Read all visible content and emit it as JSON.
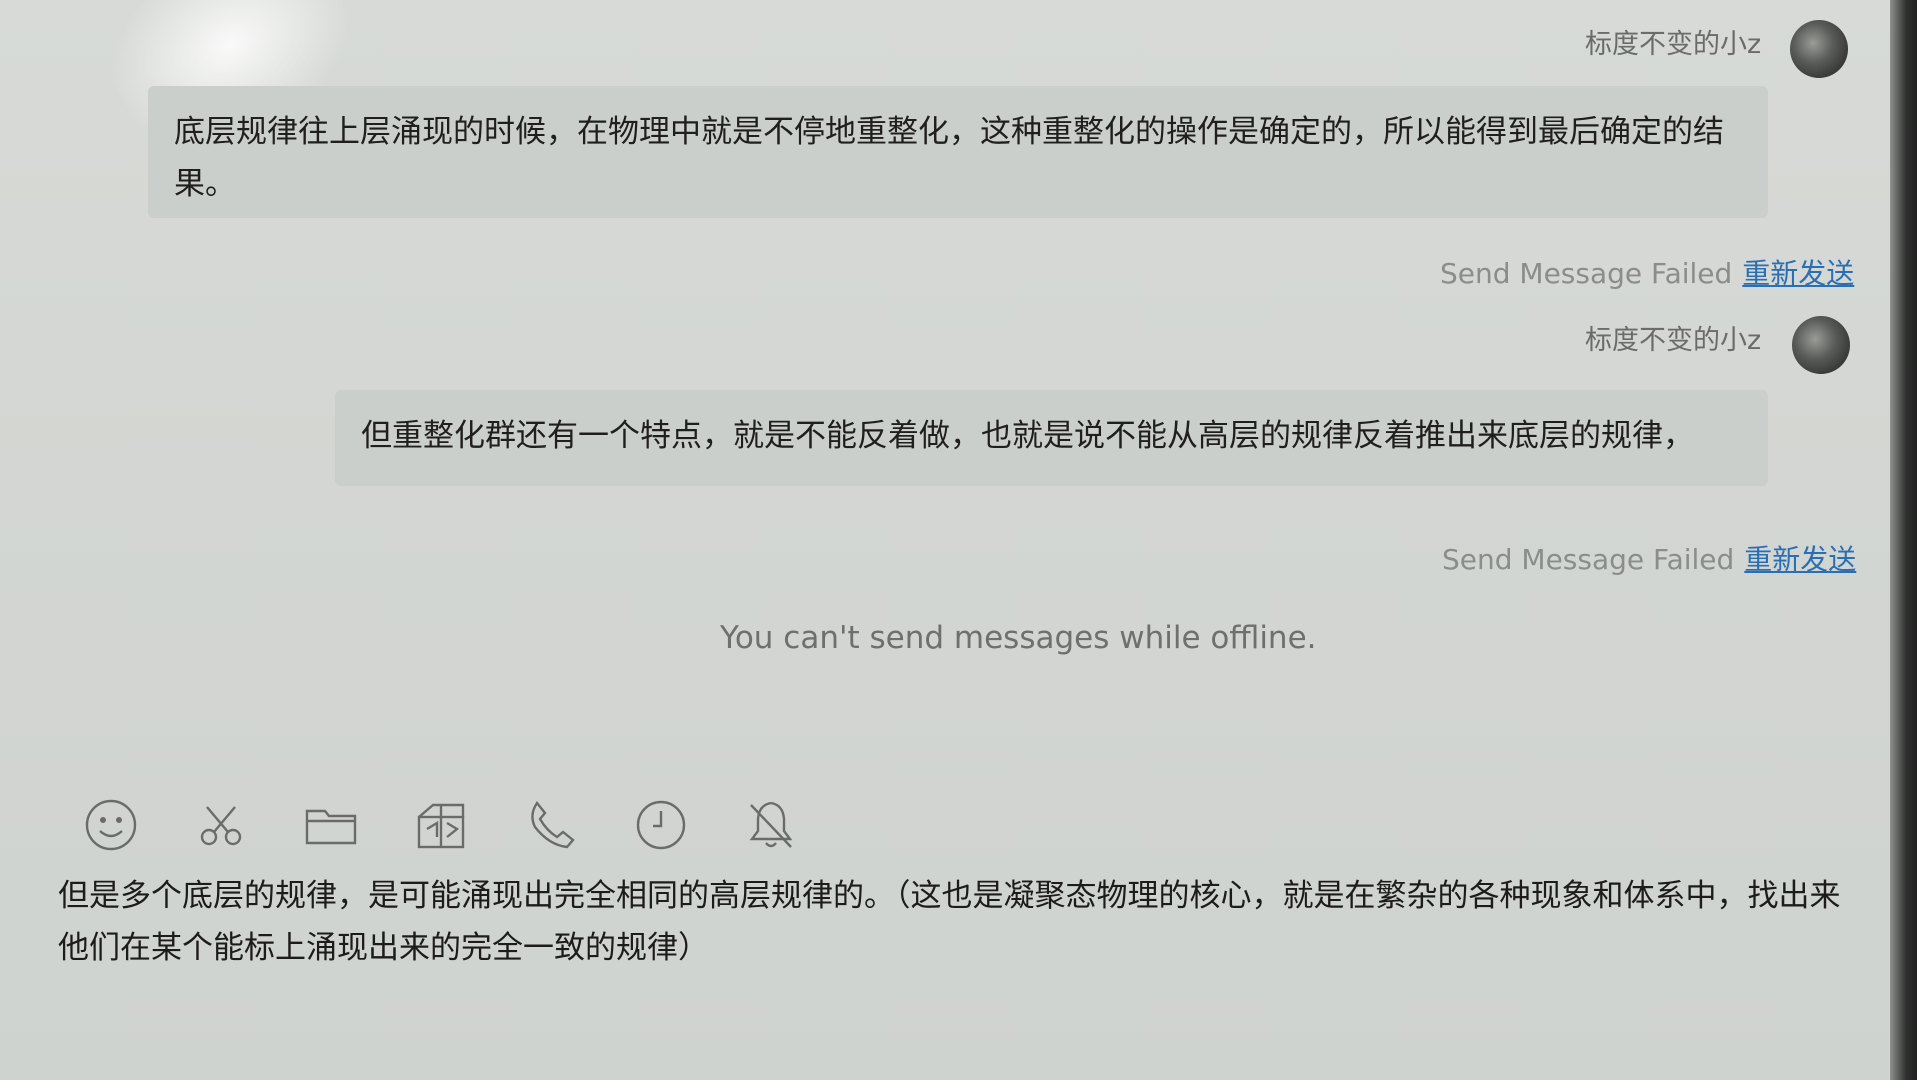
{
  "messages": [
    {
      "sender": "标度不变的小z",
      "text": "底层规律往上层涌现的时候，在物理中就是不停地重整化，这种重整化的操作是确定的，所以能得到最后确定的结果。",
      "status": "Send Message Failed",
      "resend_label": "重新发送"
    },
    {
      "sender": "标度不变的小z",
      "text": "但重整化群还有一个特点，就是不能反着做，也就是说不能从高层的规律反着推出来底层的规律，",
      "status": "Send Message Failed",
      "resend_label": "重新发送"
    }
  ],
  "offline_notice": "You can't send messages while offline.",
  "toolbar": {
    "icons": [
      "emoji-icon",
      "scissors-icon",
      "folder-icon",
      "gift-icon",
      "phone-icon",
      "clock-icon",
      "bell-off-icon"
    ]
  },
  "input": {
    "value": "但是多个底层的规律，是可能涌现出完全相同的高层规律的。（这也是凝聚态物理的核心，就是在繁杂的各种现象和体系中，找出来他们在某个能标上涌现出来的完全一致的规律）"
  },
  "colors": {
    "background": "#d5d8d4",
    "bubble": "#cbcfcb",
    "resend_link": "#2b6fb3",
    "muted_text": "#8a8d8a"
  }
}
